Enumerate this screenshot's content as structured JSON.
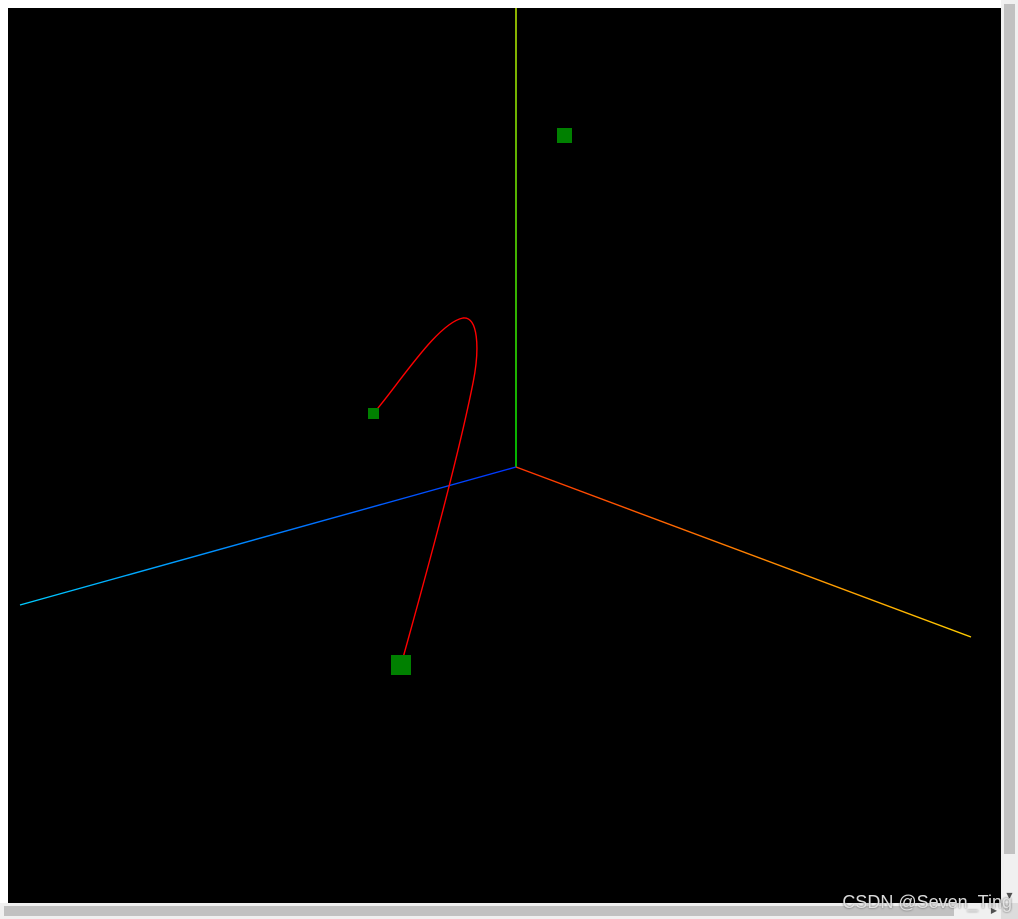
{
  "scene": {
    "background_color": "#000000",
    "axes": [
      {
        "name": "y-axis",
        "color_start": "#00ff00",
        "color_end": "#ffff00"
      },
      {
        "name": "x-axis",
        "color_start": "#ff3300",
        "color_end": "#ffcc00"
      },
      {
        "name": "z-axis",
        "color_start": "#0033ff",
        "color_end": "#00ccff"
      }
    ],
    "curve": {
      "color": "#ff0000"
    },
    "control_point_color": "#008000"
  },
  "scrollbars": {
    "up_arrow": "▲",
    "down_arrow": "▼",
    "left_arrow": "◀",
    "right_arrow": "▶"
  },
  "watermark": "CSDN @Seven_Ting"
}
